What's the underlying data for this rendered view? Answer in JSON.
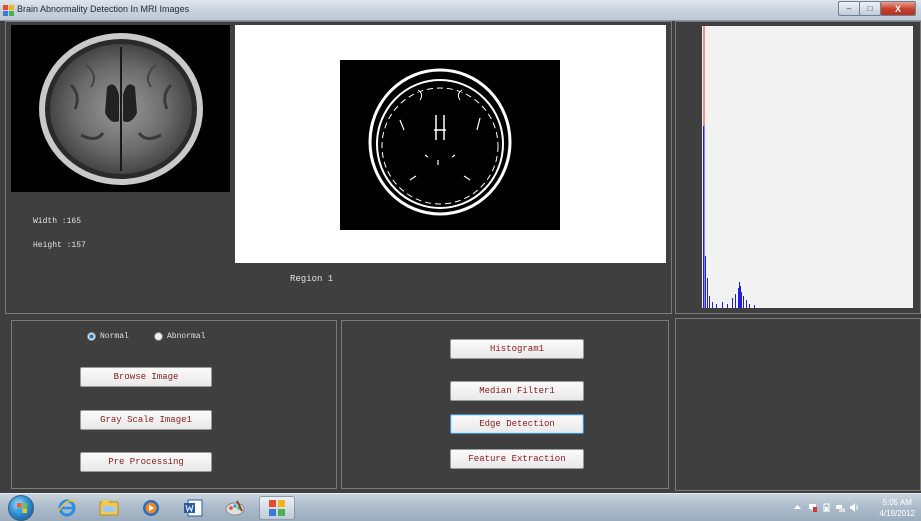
{
  "window": {
    "title": "Brain Abnormality Detection In MRI Images",
    "minimize": "–",
    "maximize": "□",
    "close": "X"
  },
  "image_info": {
    "width_label": "Width :165",
    "height_label": "Height :157"
  },
  "region_label": "Region 1",
  "classification": {
    "options": [
      "Normal",
      "Abnormal"
    ],
    "selected": "Normal"
  },
  "buttons": {
    "browse": "Browse Image",
    "gray_scale": "Gray Scale Image1",
    "pre_processing": "Pre Processing",
    "histogram": "Histogram1",
    "median_filter": "Median Filter1",
    "edge_detection": "Edge Detection",
    "feature_extraction": "Feature Extraction"
  },
  "taskbar": {
    "items": [
      "start-button",
      "ie-icon",
      "explorer-icon",
      "media-player-icon",
      "word-icon",
      "paint-icon",
      "app-icon"
    ],
    "clock_time": "5:05 AM",
    "clock_date": "4/19/2012"
  },
  "colors": {
    "background": "#3f3f3f",
    "button_text": "#8b1a1a",
    "histogram_bar": "#1f1fe0",
    "histogram_marker": "#e03030"
  }
}
